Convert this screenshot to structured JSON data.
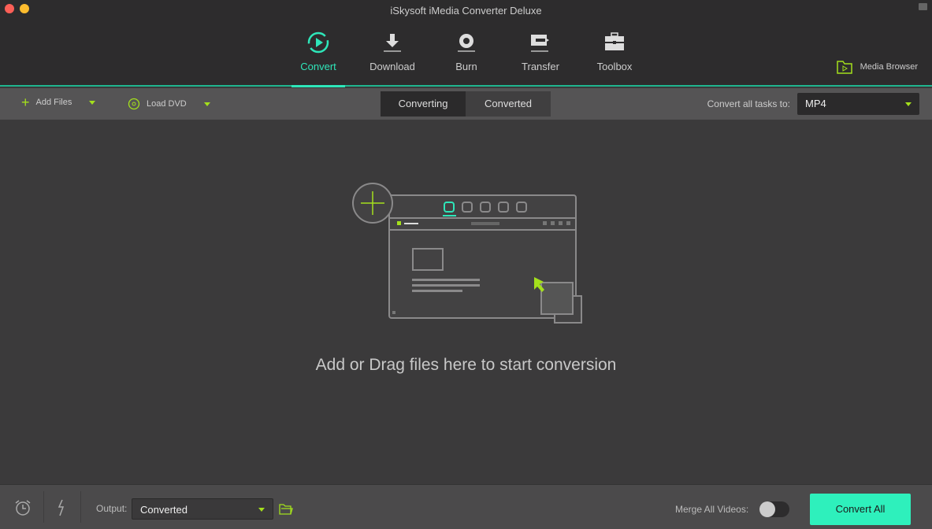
{
  "window": {
    "title": "iSkysoft iMedia Converter Deluxe"
  },
  "nav": [
    {
      "label": "Convert",
      "icon": "convert-icon"
    },
    {
      "label": "Download",
      "icon": "download-icon"
    },
    {
      "label": "Burn",
      "icon": "burn-icon"
    },
    {
      "label": "Transfer",
      "icon": "transfer-icon"
    },
    {
      "label": "Toolbox",
      "icon": "toolbox-icon"
    }
  ],
  "media_browser": "Media Browser",
  "toolbar": {
    "add_files": "Add Files",
    "load_dvd": "Load DVD",
    "tabs": [
      "Converting",
      "Converted"
    ],
    "convert_all_label": "Convert all tasks to:",
    "format": "MP4"
  },
  "main": {
    "drop_text": "Add or Drag files here to start conversion"
  },
  "bottom": {
    "output_label": "Output:",
    "output_value": "Converted",
    "merge_label": "Merge All Videos:",
    "merge_on": false,
    "convert_all": "Convert All"
  },
  "colors": {
    "accent": "#2ee6b9",
    "green": "#a4e01c"
  }
}
